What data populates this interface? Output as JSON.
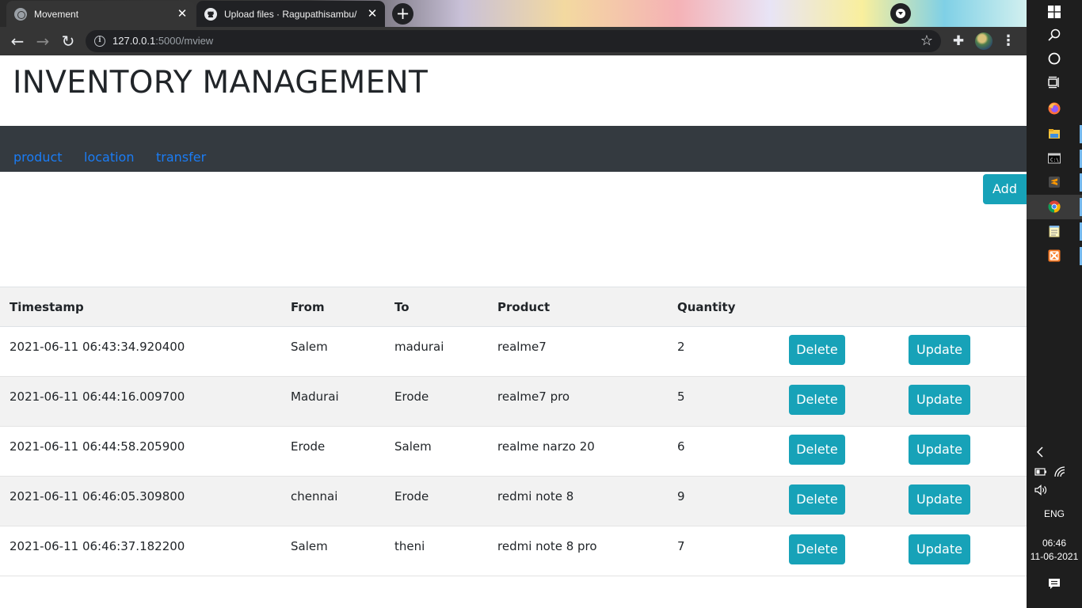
{
  "browser": {
    "tabs": [
      {
        "title": "Movement",
        "active": true
      },
      {
        "title": "Upload files · Ragupathisambu/in",
        "active": false
      }
    ],
    "url_host": "127.0.0.1",
    "url_path": ":5000/mview"
  },
  "page": {
    "title": "INVENTORY MANAGEMENT",
    "nav": [
      "product",
      "location",
      "transfer"
    ],
    "add_label": "Add",
    "accent_color": "#17a2b8",
    "navbar_color": "#343a40",
    "link_color": "#1a7cf5"
  },
  "table": {
    "headers": [
      "Timestamp",
      "From",
      "To",
      "Product",
      "Quantity"
    ],
    "delete_label": "Delete",
    "update_label": "Update",
    "rows": [
      {
        "timestamp": "2021-06-11 06:43:34.920400",
        "from": "Salem",
        "to": "madurai",
        "product": "realme7",
        "quantity": "2"
      },
      {
        "timestamp": "2021-06-11 06:44:16.009700",
        "from": "Madurai",
        "to": "Erode",
        "product": "realme7 pro",
        "quantity": "5"
      },
      {
        "timestamp": "2021-06-11 06:44:58.205900",
        "from": "Erode",
        "to": "Salem",
        "product": "realme narzo 20",
        "quantity": "6"
      },
      {
        "timestamp": "2021-06-11 06:46:05.309800",
        "from": "chennai",
        "to": "Erode",
        "product": "redmi note 8",
        "quantity": "9"
      },
      {
        "timestamp": "2021-06-11 06:46:37.182200",
        "from": "Salem",
        "to": "theni",
        "product": "redmi note 8 pro",
        "quantity": "7"
      }
    ]
  },
  "taskbar": {
    "apps": [
      "windows-start-icon",
      "search-icon",
      "cortana-icon",
      "task-view-icon",
      "firefox-icon",
      "file-explorer-icon",
      "cmd-icon",
      "sublime-text-icon",
      "chrome-icon",
      "notepad-icon",
      "xampp-icon"
    ],
    "language": "ENG",
    "time": "06:46",
    "date": "11-06-2021"
  }
}
